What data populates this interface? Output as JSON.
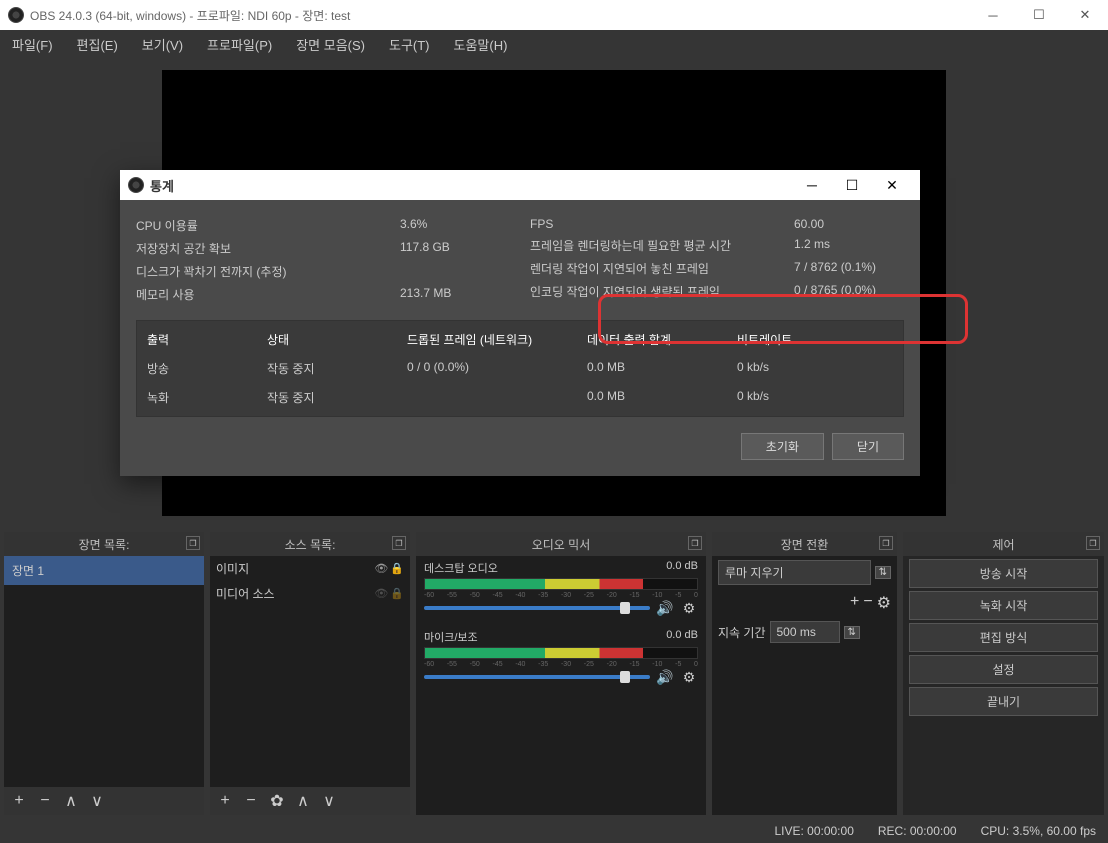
{
  "window": {
    "title": "OBS 24.0.3 (64-bit, windows) - 프로파일: NDI 60p - 장면: test"
  },
  "menu": [
    "파일(F)",
    "편집(E)",
    "보기(V)",
    "프로파일(P)",
    "장면 모음(S)",
    "도구(T)",
    "도움말(H)"
  ],
  "panels": {
    "scenes": {
      "title": "장면 목록:",
      "items": [
        "장면 1"
      ]
    },
    "sources": {
      "title": "소스 목록:",
      "items": [
        "이미지",
        "미디어 소스"
      ]
    },
    "mixer": {
      "title": "오디오 믹서",
      "tracks": [
        {
          "name": "데스크탑 오디오",
          "db": "0.0 dB"
        },
        {
          "name": "마이크/보조",
          "db": "0.0 dB"
        }
      ]
    },
    "transitions": {
      "title": "장면 전환",
      "selected": "루마 지우기",
      "duration_label": "지속 기간",
      "duration": "500 ms"
    },
    "controls": {
      "title": "제어",
      "buttons": [
        "방송 시작",
        "녹화 시작",
        "편집 방식",
        "설정",
        "끝내기"
      ]
    }
  },
  "statusbar": {
    "live": "LIVE: 00:00:00",
    "rec": "REC: 00:00:00",
    "cpu": "CPU: 3.5%, 60.00 fps"
  },
  "stats": {
    "title": "통계",
    "left": [
      {
        "label": "CPU 이용률",
        "val": "3.6%"
      },
      {
        "label": "저장장치 공간 확보",
        "val": "117.8 GB"
      },
      {
        "label": "디스크가 꽉차기 전까지 (추정)",
        "val": ""
      },
      {
        "label": "메모리 사용",
        "val": "213.7 MB"
      }
    ],
    "right": [
      {
        "label": "FPS",
        "val": "60.00"
      },
      {
        "label": "프레임을 렌더링하는데 필요한 평균 시간",
        "val": "1.2 ms"
      },
      {
        "label": "렌더링 작업이 지연되어 놓친 프레임",
        "val": "7 / 8762 (0.1%)"
      },
      {
        "label": "인코딩 작업이 지연되어 생략된 프레임",
        "val": "0 / 8765 (0.0%)"
      }
    ],
    "table": {
      "headers": [
        "출력",
        "상태",
        "드롭된 프레임 (네트워크)",
        "데이터 출력 합계",
        "비트레이트"
      ],
      "rows": [
        [
          "방송",
          "작동 중지",
          "0 / 0 (0.0%)",
          "0.0 MB",
          "0 kb/s"
        ],
        [
          "녹화",
          "작동 중지",
          "",
          "0.0 MB",
          "0 kb/s"
        ]
      ]
    },
    "buttons": {
      "reset": "초기화",
      "close": "닫기"
    }
  }
}
